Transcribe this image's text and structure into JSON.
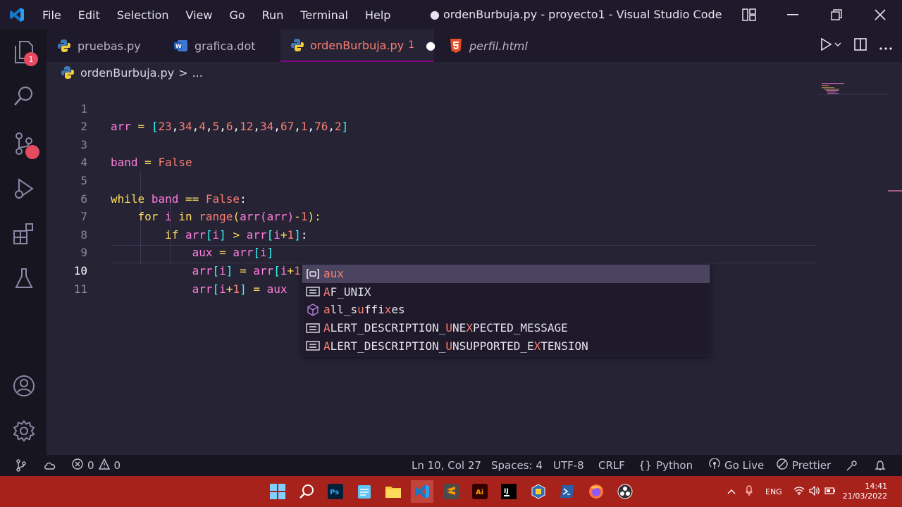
{
  "window": {
    "title": "● ordenBurbuja.py - proyecto1 - Visual Studio Code"
  },
  "menu": [
    "File",
    "Edit",
    "Selection",
    "View",
    "Go",
    "Run",
    "Terminal",
    "Help"
  ],
  "activity": {
    "explorer_badge": "1"
  },
  "tabs": [
    {
      "label": "pruebas.py",
      "icon": "python-icon"
    },
    {
      "label": "grafica.dot",
      "icon": "word-icon"
    },
    {
      "label": "ordenBurbuja.py",
      "icon": "python-icon",
      "problems": "1",
      "dirty": "●"
    },
    {
      "label": "perfil.html",
      "icon": "html5-icon"
    }
  ],
  "breadcrumb": {
    "file": "ordenBurbuja.py",
    "sep": ">",
    "rest": "..."
  },
  "editor": {
    "line_numbers": [
      "1",
      "2",
      "3",
      "4",
      "5",
      "6",
      "7",
      "8",
      "9",
      "10",
      "11"
    ],
    "current_line": "10"
  },
  "suggest": {
    "items": [
      {
        "pre": "",
        "match": "aux",
        "post": "",
        "icon": "variable-icon"
      },
      {
        "pre": "",
        "match": "A",
        "post": "F_UNIX",
        "icon": "constant-icon"
      },
      {
        "pre": "all_s",
        "match": "u",
        "post": "ffixes",
        "pre2": "",
        "icon": "module-icon"
      },
      {
        "pre": "",
        "match": "A",
        "post": "LERT_DESCRIPTION_",
        "match2": "U",
        "post2": "NE",
        "match3": "X",
        "post3": "PECTED_MESSAGE",
        "icon": "constant-icon"
      },
      {
        "pre": "",
        "match": "A",
        "post": "LERT_DESCRIPTION_",
        "match2": "U",
        "post2": "NSUPPORTED_E",
        "match3": "X",
        "post3": "TENSION",
        "icon": "constant-icon"
      }
    ]
  },
  "status": {
    "errors": "0",
    "warnings": "0",
    "position": "Ln 10, Col 27",
    "spaces": "Spaces: 4",
    "encoding": "UTF-8",
    "eol": "CRLF",
    "language": "Python",
    "golive": "Go Live",
    "prettier": "Prettier"
  },
  "taskbar": {
    "lang": "ENG",
    "time": "14:41",
    "date": "21/03/2022"
  }
}
